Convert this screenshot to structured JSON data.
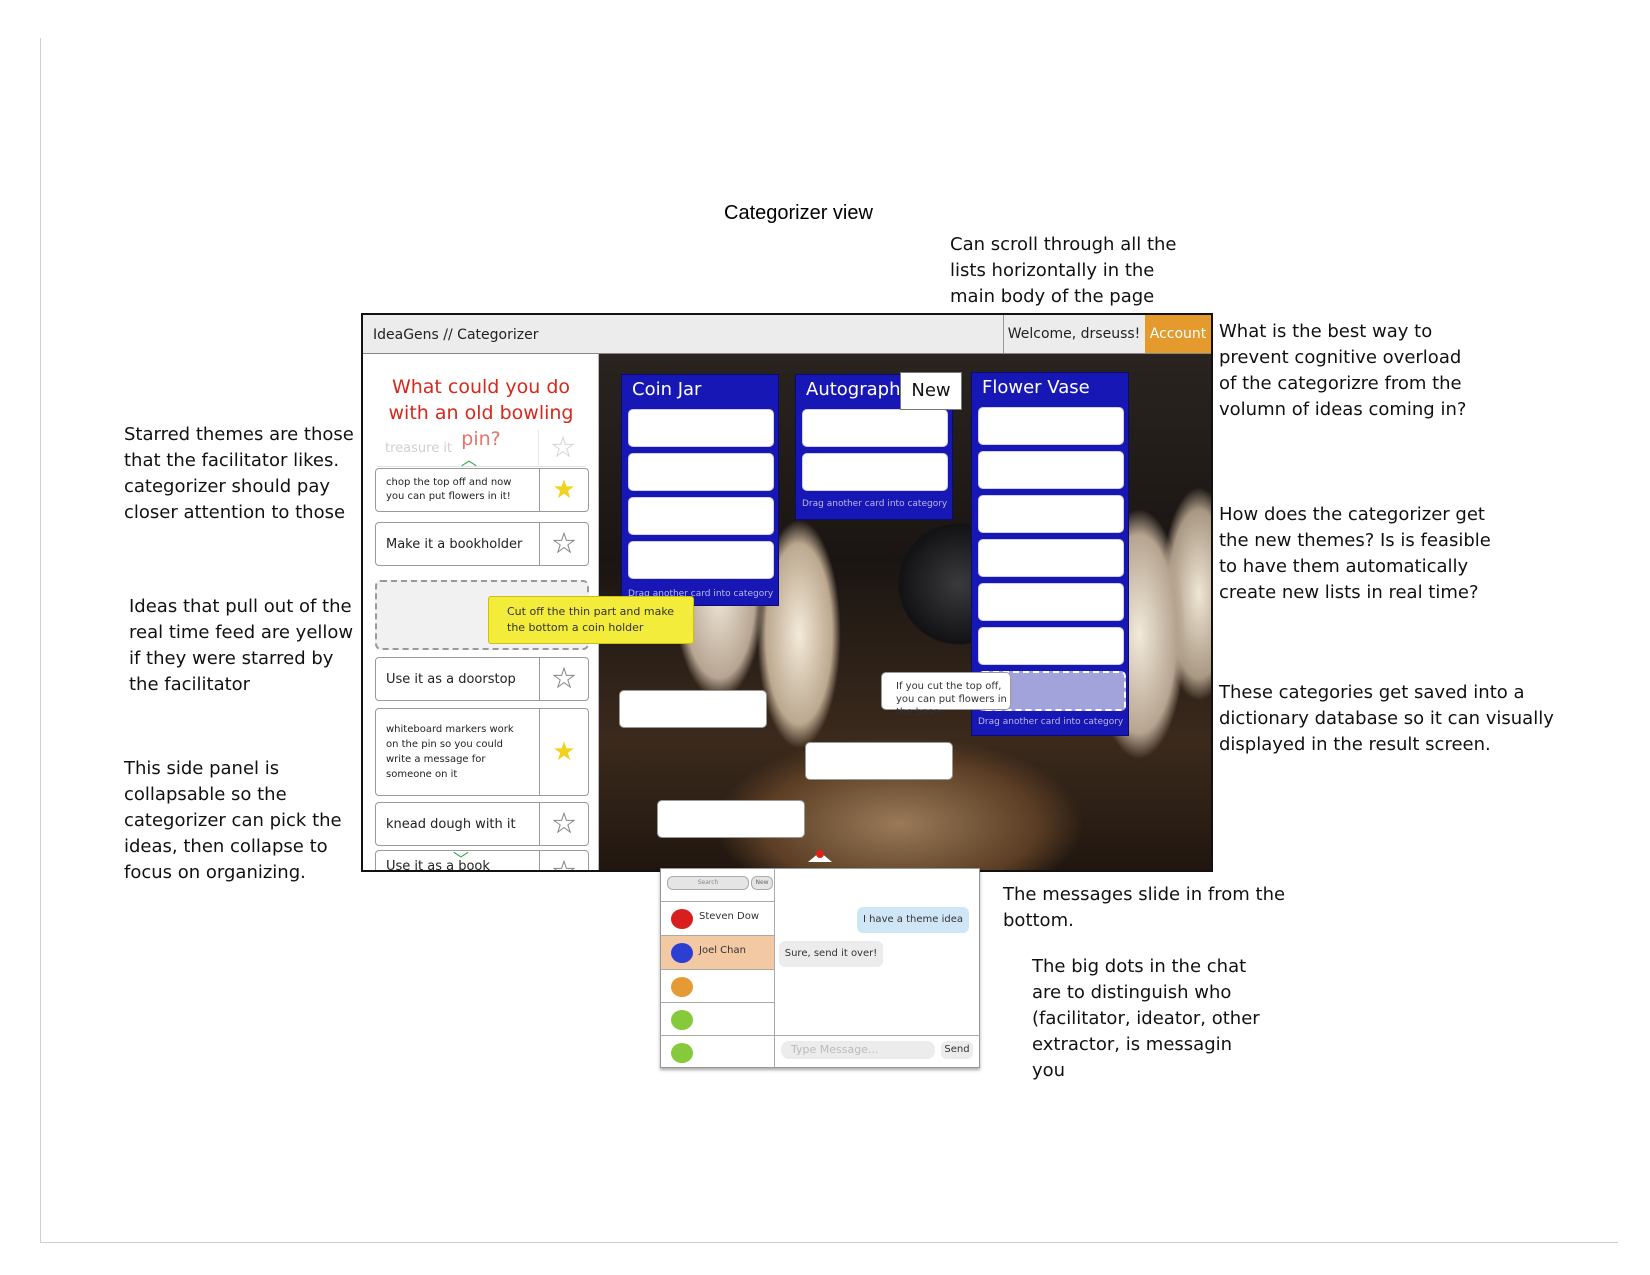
{
  "page_title": "Categorizer view",
  "annotations": {
    "scroll_note": "Can scroll through all the\nlists horizontally in the\nmain body of the page",
    "overload_note": "What is the best way to\nprevent cognitive overload\nof the categorizre from the\nvolumn of ideas coming in?",
    "themes_note": "How does the categorizer get\nthe new themes? Is is feasible\nto have them automatically\ncreate new lists in real time?",
    "save_note": "These categories get saved into a\ndictionary database so it can visually\ndisplayed in the result screen.",
    "starred_note": "Starred themes are those\nthat the facilitator likes.\ncategorizer should pay\ncloser attention to those",
    "yellow_note": "Ideas that pull out of the\nreal time feed are yellow\nif they were starred by\nthe facilitator",
    "collapse_note": "This side panel is\ncollapsable so the\ncategorizer can pick the\nideas, then collapse to\nfocus on organizing.",
    "messages_note": "The messages slide in from the\nbottom.",
    "dots_note": "The big dots in the chat\nare to distinguish who\n(facilitator, ideator, other\nextractor, is messagin\nyou"
  },
  "app": {
    "name": "IdeaGens // Categorizer",
    "welcome": "Welcome, drseuss!",
    "account_label": "Account",
    "new_label": "New"
  },
  "sidebar": {
    "question": "What could you do with an old bowling pin?",
    "ideas": [
      {
        "text": "treasure it",
        "starred": false
      },
      {
        "text": "chop the top off and now you can put flowers in it!",
        "starred": true
      },
      {
        "text": "Make it a bookholder",
        "starred": false
      },
      {
        "text": "",
        "starred": false
      },
      {
        "text": "Use it as a doorstop",
        "starred": false
      },
      {
        "text": "whiteboard markers work on the pin so you could write a message for someone on it",
        "starred": true
      },
      {
        "text": "knead dough with it",
        "starred": false
      },
      {
        "text": "Use it as a book weight",
        "starred": false
      }
    ],
    "dragged_idea": "Cut off the thin part and make the bottom a coin holder"
  },
  "lists": [
    {
      "title": "Coin Jar",
      "hint": "Drag another card into category"
    },
    {
      "title": "Autograph it",
      "hint": "Drag another card into category"
    },
    {
      "title": "Flower Vase",
      "hint": "Drag another card into category"
    }
  ],
  "floating_card": "If you cut the top off, you can put flowers in the base",
  "chat": {
    "search_placeholder": "Search",
    "new_label": "New",
    "contacts": [
      {
        "name": "Steven Dow",
        "color": "#d81e1e"
      },
      {
        "name": "Joel Chan",
        "color": "#2d3fd3"
      },
      {
        "name": "",
        "color": "#e59a36"
      },
      {
        "name": "",
        "color": "#86c93a"
      },
      {
        "name": "",
        "color": "#86c93a"
      }
    ],
    "messages": [
      {
        "text": "I have a theme idea",
        "side": "right"
      },
      {
        "text": "Sure, send it over!",
        "side": "left"
      }
    ],
    "input_placeholder": "Type Message...",
    "send_label": "Send"
  },
  "colors": {
    "accent_orange": "#e49a2c",
    "list_blue": "#1717b5",
    "question_red": "#d7281c",
    "starred_yellow": "#f3ec3a",
    "selected_contact": "#f3c9a4"
  }
}
